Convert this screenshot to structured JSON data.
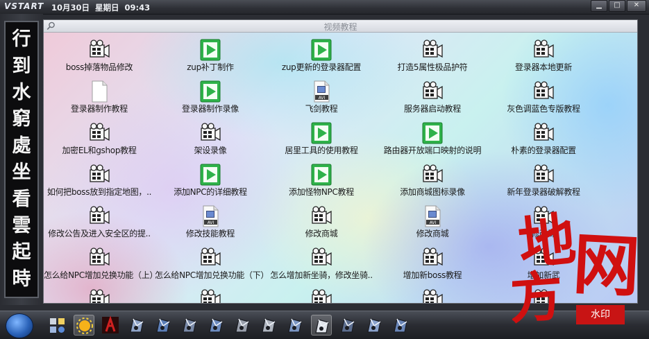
{
  "topbar": {
    "logo": "VSTART",
    "datetime": "10月30日  星期日  09:43",
    "buttons": [
      "minimize",
      "maximize",
      "close"
    ]
  },
  "side_poem": [
    "行",
    "到",
    "水",
    "窮",
    "處",
    "坐",
    "看",
    "雲",
    "起",
    "時"
  ],
  "window": {
    "title": "视频教程",
    "items": [
      {
        "label": "boss掉落物品修改",
        "icon": "video-camera-icon"
      },
      {
        "label": "zup补丁制作",
        "icon": "green-play-icon"
      },
      {
        "label": "zup更新的登录器配置",
        "icon": "green-play-icon"
      },
      {
        "label": "打造5属性极品护符",
        "icon": "video-camera-icon"
      },
      {
        "label": "登录器本地更新",
        "icon": "video-camera-icon"
      },
      {
        "label": "登录器制作教程",
        "icon": "blank-document-icon"
      },
      {
        "label": "登录器制作录像",
        "icon": "green-play-icon"
      },
      {
        "label": "飞剑教程",
        "icon": "avi-file-icon"
      },
      {
        "label": "服务器启动教程",
        "icon": "video-camera-icon"
      },
      {
        "label": "灰色调蓝色专版教程",
        "icon": "video-camera-icon"
      },
      {
        "label": "加密EL和gshop教程",
        "icon": "video-camera-icon"
      },
      {
        "label": "架设录像",
        "icon": "video-camera-icon"
      },
      {
        "label": "居里工具的使用教程",
        "icon": "green-play-icon"
      },
      {
        "label": "路由器开放端口映射的说明",
        "icon": "green-play-icon"
      },
      {
        "label": "朴素的登录器配置",
        "icon": "video-camera-icon"
      },
      {
        "label": "如何把boss放到指定地图，..",
        "icon": "video-camera-icon"
      },
      {
        "label": "添加NPC的详细教程",
        "icon": "green-play-icon"
      },
      {
        "label": "添加怪物NPC教程",
        "icon": "green-play-icon"
      },
      {
        "label": "添加商城图标录像",
        "icon": "video-camera-icon"
      },
      {
        "label": "新年登录器破解教程",
        "icon": "video-camera-icon"
      },
      {
        "label": "修改公告及进入安全区的提..",
        "icon": "video-camera-icon"
      },
      {
        "label": "修改技能教程",
        "icon": "avi-file-icon"
      },
      {
        "label": "修改商城",
        "icon": "video-camera-icon"
      },
      {
        "label": "修改商城",
        "icon": "avi-file-icon"
      },
      {
        "label": "修改诛",
        "icon": "video-camera-icon"
      },
      {
        "label": "怎么给NPC增加兑换功能（上）",
        "icon": "video-camera-icon"
      },
      {
        "label": "怎么给NPC增加兑换功能（下）",
        "icon": "video-camera-icon"
      },
      {
        "label": "怎么增加新坐骑，修改坐骑..",
        "icon": "video-camera-icon"
      },
      {
        "label": "增加新boss教程",
        "icon": "video-camera-icon"
      },
      {
        "label": "增加新武",
        "icon": "video-camera-icon"
      },
      {
        "label": "",
        "icon": "video-camera-icon"
      },
      {
        "label": "",
        "icon": "video-camera-icon"
      },
      {
        "label": "",
        "icon": "video-camera-icon"
      },
      {
        "label": "",
        "icon": "video-camera-icon"
      },
      {
        "label": "",
        "icon": "video-camera-icon"
      }
    ]
  },
  "taskbar": {
    "icons": [
      "start-orb-icon",
      "quick-launch-icon",
      "sun-icon",
      "red-figure-icon",
      "app-icon",
      "app-icon",
      "app-icon",
      "app-icon",
      "app-icon",
      "app-icon",
      "app-icon",
      "app-icon",
      "app-icon",
      "app-icon",
      "app-icon"
    ]
  },
  "watermark": {
    "text": "地方网",
    "badge": "水印"
  },
  "colors": {
    "accent_red": "#c81414",
    "poem_background": "#0c0c0e"
  }
}
